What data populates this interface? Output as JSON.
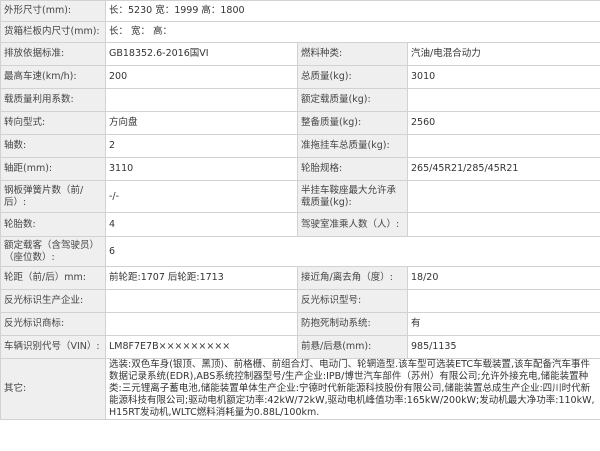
{
  "rows": [
    {
      "type": "full",
      "label": "外形尺寸(mm):",
      "value": "长：5230 宽：1999 高：1800"
    },
    {
      "type": "full",
      "label": "货箱栏板内尺寸(mm):",
      "value": "长：  宽：  高："
    },
    {
      "type": "pair",
      "l1": "排放依据标准:",
      "v1": "GB18352.6-2016国VI",
      "l2": "燃料种类:",
      "v2": "汽油/电混合动力"
    },
    {
      "type": "pair",
      "l1": "最高车速(km/h):",
      "v1": "200",
      "l2": "总质量(kg):",
      "v2": "3010"
    },
    {
      "type": "pair",
      "l1": "载质量利用系数:",
      "v1": "",
      "l2": "额定载质量(kg):",
      "v2": ""
    },
    {
      "type": "pair",
      "l1": "转向型式:",
      "v1": "方向盘",
      "l2": "整备质量(kg):",
      "v2": "2560"
    },
    {
      "type": "pair",
      "l1": "轴数:",
      "v1": "2",
      "l2": "准拖挂车总质量(kg):",
      "v2": ""
    },
    {
      "type": "pair",
      "l1": "轴距(mm):",
      "v1": "3110",
      "l2": "轮胎规格:",
      "v2": "265/45R21/285/45R21"
    },
    {
      "type": "pair",
      "l1": "钢板弹簧片数（前/后）:",
      "v1": "-/-",
      "l2": "半挂车鞍座最大允许承载质量(kg):",
      "v2": ""
    },
    {
      "type": "pair",
      "l1": "轮胎数:",
      "v1": "4",
      "l2": "驾驶室准乘人数（人）:",
      "v2": ""
    },
    {
      "type": "full",
      "label": "额定载客（含驾驶员）（座位数）:",
      "value": "6"
    },
    {
      "type": "pair",
      "l1": "轮距（前/后）mm:",
      "v1": "前轮距:1707 后轮距:1713",
      "l2": "接近角/离去角（度）:",
      "v2": "18/20"
    },
    {
      "type": "pair",
      "l1": "反光标识生产企业:",
      "v1": "",
      "l2": "反光标识型号:",
      "v2": ""
    },
    {
      "type": "pair",
      "l1": "反光标识商标:",
      "v1": "",
      "l2": "防抱死制动系统:",
      "v2": "有"
    },
    {
      "type": "pair",
      "l1": "车辆识别代号（VIN）:",
      "v1": "LM8F7E7B×××××××××",
      "l2": "前悬/后悬(mm):",
      "v2": "985/1135"
    },
    {
      "type": "other",
      "label": "其它:",
      "value": "选装:双色车身(银顶、黑顶)、前格栅、前组合灯、电动门、轮辋造型.该车型可选装ETC车载装置,该车配备汽车事件数据记录系统(EDR),ABS系统控制器型号/生产企业:IPB/博世汽车部件（苏州）有限公司;允许外接充电,储能装置种类:三元锂离子蓄电池,储能装置单体生产企业:宁德时代新能源科技股份有限公司,储能装置总成生产企业:四川时代新能源科技有限公司;驱动电机额定功率:42kW/72kW,驱动电机峰值功率:165kW/200kW;发动机最大净功率:110kW,H15RT发动机,WLTC燃料消耗量为0.88L/100km."
    }
  ]
}
